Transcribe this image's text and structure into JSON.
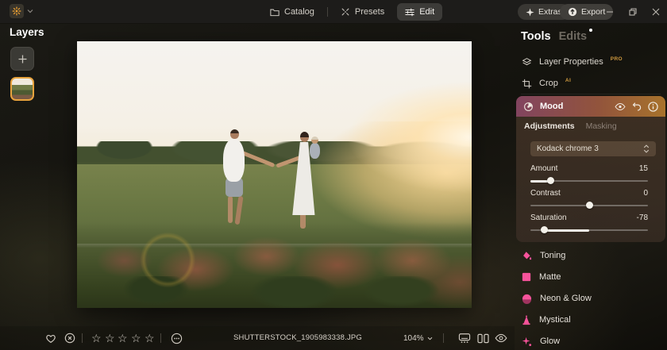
{
  "window": {
    "controls": [
      {
        "name": "minimize"
      },
      {
        "name": "restore"
      },
      {
        "name": "close"
      }
    ]
  },
  "top_bar": {
    "logo_icon": "luminar-sun-icon",
    "tabs": [
      {
        "label": "Catalog",
        "icon": "folder-icon",
        "active": false
      },
      {
        "label": "Presets",
        "icon": "wand-sparkle-icon",
        "active": false
      },
      {
        "label": "Edit",
        "icon": "sliders-icon",
        "active": true
      }
    ],
    "extras_button": {
      "label": "Extras",
      "icon": "four-point-star-icon"
    },
    "export_button": {
      "label": "Export",
      "icon": "export-arrow-icon"
    }
  },
  "layers_panel": {
    "title": "Layers",
    "add_button_icon": "plus-icon",
    "selected_layer": "photo-thumbnail"
  },
  "right_panel": {
    "header": {
      "tools_tab": "Tools",
      "edits_tab": "Edits",
      "edits_notification_dot": true
    },
    "sections": [
      {
        "label": "Layer Properties",
        "badge": "PRO",
        "icon": "layers-icon"
      },
      {
        "label": "Crop",
        "badge": "AI",
        "icon": "crop-icon"
      }
    ],
    "mood": {
      "title": "Mood",
      "icon": "aperture-icon",
      "header_icons": [
        "eye-icon",
        "undo-icon",
        "info-icon"
      ],
      "tabs": [
        {
          "label": "Adjustments",
          "active": true
        },
        {
          "label": "Masking",
          "active": false
        }
      ],
      "preset": {
        "value": "Kodack chrome 3",
        "chevron": "updown-chevron-icon"
      },
      "sliders": [
        {
          "label": "Amount",
          "value": "15"
        },
        {
          "label": "Contrast",
          "value": "0"
        },
        {
          "label": "Saturation",
          "value": "-78"
        }
      ]
    },
    "tools": [
      {
        "label": "Toning",
        "icon": "paint-bucket-icon"
      },
      {
        "label": "Matte",
        "icon": "matte-square-icon"
      },
      {
        "label": "Neon & Glow",
        "icon": "neon-circle-icon"
      },
      {
        "label": "Mystical",
        "icon": "mystical-cone-icon"
      },
      {
        "label": "Glow",
        "icon": "glow-sparkle-icon"
      }
    ]
  },
  "bottom_bar": {
    "favorite_icon": "heart-icon",
    "reject_icon": "reject-circle-icon",
    "rating": {
      "stars_total": 5,
      "stars_filled": 0,
      "star_glyph": "☆"
    },
    "more_icon": "more-dots-icon",
    "filename": "SHUTTERSTOCK_1905983338.JPG",
    "zoom_level": "104%",
    "view_icons": [
      "filmstrip-icon",
      "compare-icon",
      "eye-icon"
    ]
  },
  "colors": {
    "accent_orange": "#e8a33d",
    "tool_pink": "#f7539b",
    "mood_gradient_left": "#82445f",
    "mood_gradient_right": "#a8732c",
    "badge_gold": "#cf9a3f"
  }
}
